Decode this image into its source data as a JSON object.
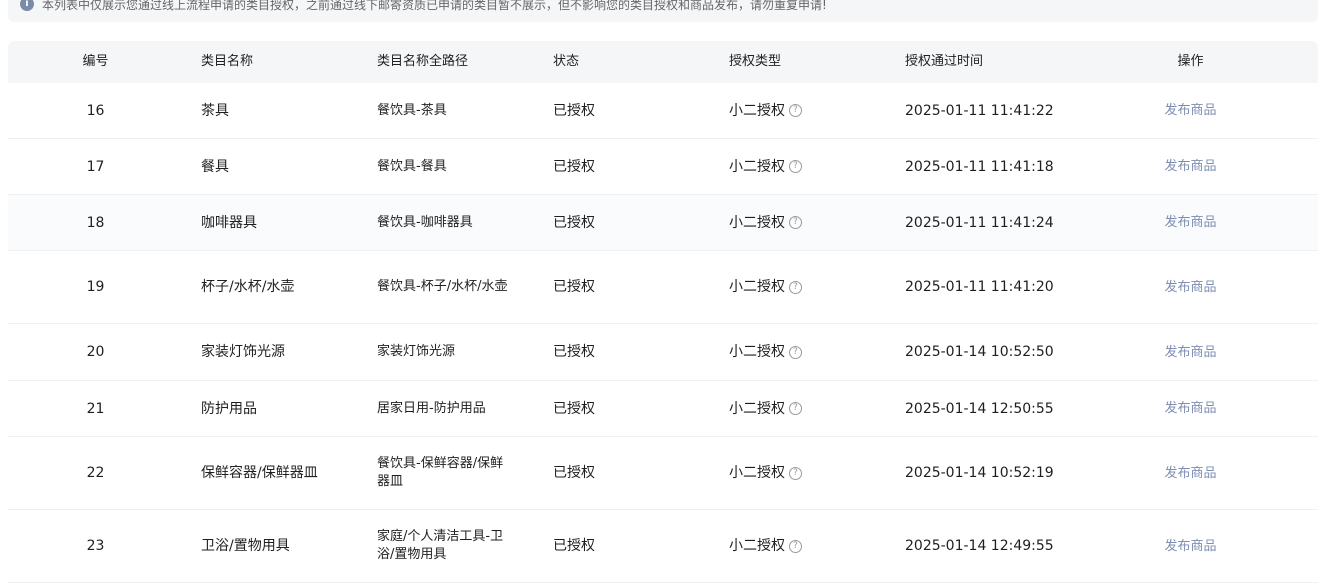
{
  "notice": {
    "text": "本列表中仅展示您通过线上流程申请的类目授权，之前通过线下邮寄资质已申请的类目暂不展示，但不影响您的类目授权和商品发布，请勿重复申请!"
  },
  "table": {
    "headers": [
      "编号",
      "类目名称",
      "类目名称全路径",
      "状态",
      "授权类型",
      "授权通过时间",
      "操作"
    ],
    "rows": [
      {
        "id": "16",
        "name": "茶具",
        "path": "餐饮具-茶具",
        "status": "已授权",
        "auth_type": "小二授权",
        "time": "2025-01-11 11:41:22",
        "action": "发布商品"
      },
      {
        "id": "17",
        "name": "餐具",
        "path": "餐饮具-餐具",
        "status": "已授权",
        "auth_type": "小二授权",
        "time": "2025-01-11 11:41:18",
        "action": "发布商品"
      },
      {
        "id": "18",
        "name": "咖啡器具",
        "path": "餐饮具-咖啡器具",
        "status": "已授权",
        "auth_type": "小二授权",
        "time": "2025-01-11 11:41:24",
        "action": "发布商品"
      },
      {
        "id": "19",
        "name": "杯子/水杯/水壶",
        "path": "餐饮具-杯子/水杯/水壶",
        "status": "已授权",
        "auth_type": "小二授权",
        "time": "2025-01-11 11:41:20",
        "action": "发布商品"
      },
      {
        "id": "20",
        "name": "家装灯饰光源",
        "path": "家装灯饰光源",
        "status": "已授权",
        "auth_type": "小二授权",
        "time": "2025-01-14 10:52:50",
        "action": "发布商品"
      },
      {
        "id": "21",
        "name": "防护用品",
        "path": "居家日用-防护用品",
        "status": "已授权",
        "auth_type": "小二授权",
        "time": "2025-01-14 12:50:55",
        "action": "发布商品"
      },
      {
        "id": "22",
        "name": "保鲜容器/保鲜器皿",
        "path": "餐饮具-保鲜容器/保鲜器皿",
        "status": "已授权",
        "auth_type": "小二授权",
        "time": "2025-01-14 10:52:19",
        "action": "发布商品"
      },
      {
        "id": "23",
        "name": "卫浴/置物用具",
        "path": "家庭/个人清洁工具-卫浴/置物用具",
        "status": "已授权",
        "auth_type": "小二授权",
        "time": "2025-01-14 12:49:55",
        "action": "发布商品"
      }
    ]
  },
  "icons": {
    "info": "info-icon",
    "help": "question-circle-icon"
  }
}
